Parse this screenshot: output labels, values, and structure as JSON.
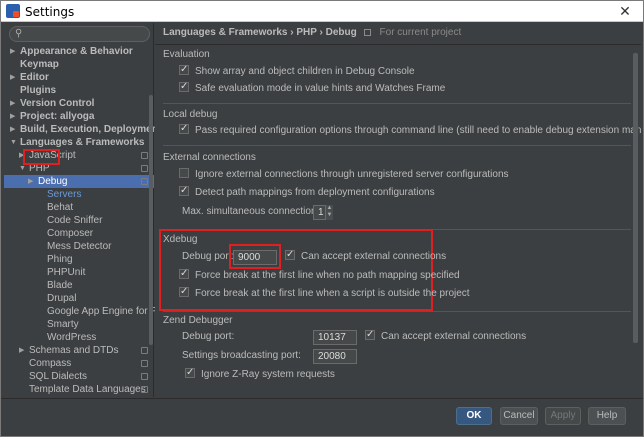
{
  "window": {
    "title": "Settings"
  },
  "search": {
    "placeholder": ""
  },
  "sidebar": {
    "items": [
      {
        "label": "Appearance & Behavior",
        "indent": 0,
        "arrow": "right",
        "bold": true
      },
      {
        "label": "Keymap",
        "indent": 0,
        "arrow": "",
        "bold": true
      },
      {
        "label": "Editor",
        "indent": 0,
        "arrow": "right",
        "bold": true
      },
      {
        "label": "Plugins",
        "indent": 0,
        "arrow": "",
        "bold": true
      },
      {
        "label": "Version Control",
        "indent": 0,
        "arrow": "right",
        "bold": true
      },
      {
        "label": "Project: allyoga",
        "indent": 0,
        "arrow": "right",
        "bold": true
      },
      {
        "label": "Build, Execution, Deployment",
        "indent": 0,
        "arrow": "right",
        "bold": true
      },
      {
        "label": "Languages & Frameworks",
        "indent": 0,
        "arrow": "down",
        "bold": true
      },
      {
        "label": "JavaScript",
        "indent": 1,
        "arrow": "right",
        "bold": false,
        "project": true
      },
      {
        "label": "PHP",
        "indent": 1,
        "arrow": "down",
        "bold": false,
        "project": true
      },
      {
        "label": "Debug",
        "indent": 2,
        "arrow": "right",
        "bold": false,
        "project": true,
        "selected": true
      },
      {
        "label": "Servers",
        "indent": 3,
        "arrow": "",
        "bold": false,
        "blue": true
      },
      {
        "label": "Behat",
        "indent": 3,
        "arrow": "",
        "bold": false
      },
      {
        "label": "Code Sniffer",
        "indent": 3,
        "arrow": "",
        "bold": false
      },
      {
        "label": "Composer",
        "indent": 3,
        "arrow": "",
        "bold": false
      },
      {
        "label": "Mess Detector",
        "indent": 3,
        "arrow": "",
        "bold": false
      },
      {
        "label": "Phing",
        "indent": 3,
        "arrow": "",
        "bold": false
      },
      {
        "label": "PHPUnit",
        "indent": 3,
        "arrow": "",
        "bold": false
      },
      {
        "label": "Blade",
        "indent": 3,
        "arrow": "",
        "bold": false
      },
      {
        "label": "Drupal",
        "indent": 3,
        "arrow": "",
        "bold": false
      },
      {
        "label": "Google App Engine for PHP",
        "indent": 3,
        "arrow": "",
        "bold": false
      },
      {
        "label": "Smarty",
        "indent": 3,
        "arrow": "",
        "bold": false
      },
      {
        "label": "WordPress",
        "indent": 3,
        "arrow": "",
        "bold": false
      },
      {
        "label": "Schemas and DTDs",
        "indent": 1,
        "arrow": "right",
        "bold": false,
        "project": true
      },
      {
        "label": "Compass",
        "indent": 1,
        "arrow": "",
        "bold": false,
        "project": true
      },
      {
        "label": "SQL Dialects",
        "indent": 1,
        "arrow": "",
        "bold": false,
        "project": true
      },
      {
        "label": "Template Data Languages",
        "indent": 1,
        "arrow": "",
        "bold": false,
        "project": true
      }
    ]
  },
  "breadcrumb": {
    "path": "Languages & Frameworks › PHP › Debug",
    "scope": "For current project"
  },
  "sections": {
    "evaluation": {
      "title": "Evaluation",
      "show_array": "Show array and object children in Debug Console",
      "safe_eval": "Safe evaluation mode in value hints and Watches Frame"
    },
    "local_debug": {
      "title": "Local debug",
      "pass_config": "Pass required configuration options through command line (still need to enable debug extension manually)"
    },
    "external": {
      "title": "External connections",
      "ignore_unregistered": "Ignore external connections through unregistered server configurations",
      "detect_mappings": "Detect path mappings from deployment configurations",
      "max_label": "Max. simultaneous connections:",
      "max_value": "1"
    },
    "xdebug": {
      "title": "Xdebug",
      "port_label": "Debug port:",
      "port_value": "9000",
      "accept_external": "Can accept external connections",
      "force_break_no_mapping": "Force break at the first line when no path mapping specified",
      "force_break_outside": "Force break at the first line when a script is outside the project"
    },
    "zend": {
      "title": "Zend Debugger",
      "port_label": "Debug port:",
      "port_value": "10137",
      "accept_external": "Can accept external connections",
      "broadcast_label": "Settings broadcasting port:",
      "broadcast_value": "20080",
      "ignore_zray": "Ignore Z-Ray system requests"
    }
  },
  "footer": {
    "ok": "OK",
    "cancel": "Cancel",
    "apply": "Apply",
    "help": "Help"
  }
}
